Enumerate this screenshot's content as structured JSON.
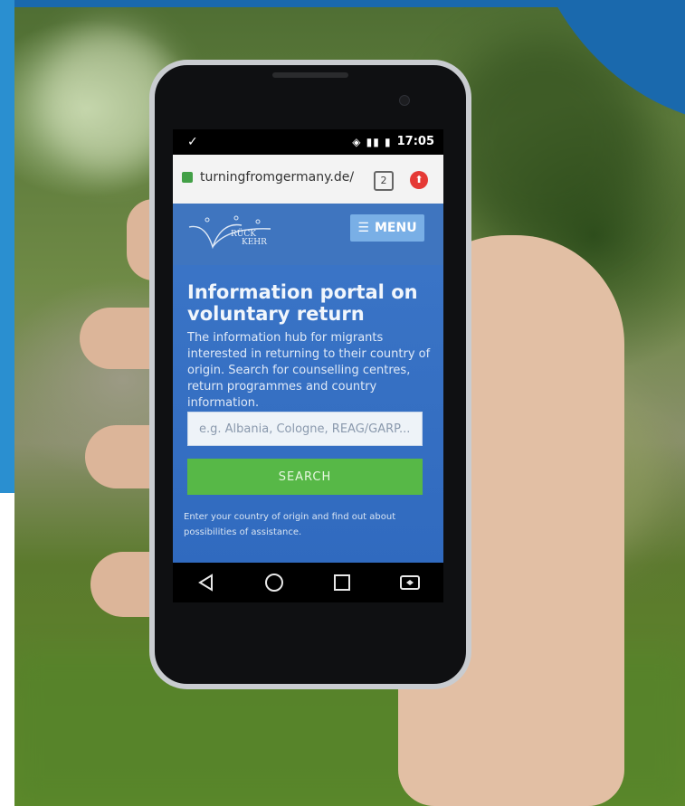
{
  "status_bar": {
    "left_icon": "download-done-icon",
    "right_icons": "signal-battery-icons",
    "time": "17:05"
  },
  "browser": {
    "url": "turningfromgermany.de/",
    "tab_count": "2",
    "lock_icon": "lock-icon",
    "update_icon": "update-icon"
  },
  "site": {
    "logo_text_line1": "RÜCK",
    "logo_text_line2": "KEHR",
    "menu_label": "MENU",
    "hero_title": "Information portal on voluntary return",
    "hero_subtitle": "The information hub for migrants interested in returning to their country of origin. Search for counselling centres, return programmes and country information.",
    "search_placeholder": "e.g. Albania, Cologne, REAG/GARP...",
    "search_button": "SEARCH",
    "hint": "Enter your country of origin and find out about possibilities of assistance."
  },
  "nav_bar": {
    "back_icon": "back-triangle-icon",
    "home_icon": "home-circle-icon",
    "recents_icon": "recents-square-icon",
    "switch_icon": "switch-sim-icon"
  },
  "colors": {
    "frame_blue": "#1a69ad",
    "hero_blue": "#3a74c6",
    "search_green": "#57b847"
  }
}
